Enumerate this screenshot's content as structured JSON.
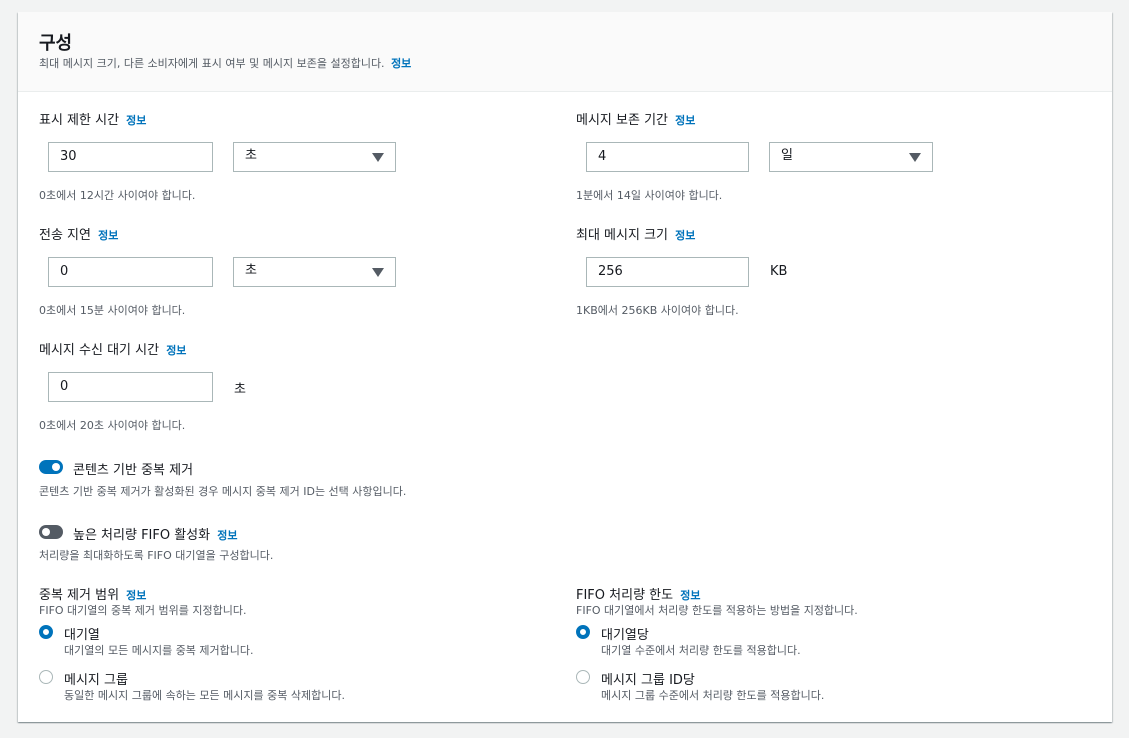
{
  "section": {
    "title": "구성",
    "description": "최대 메시지 크기, 다른 소비자에게 표시 여부 및 메시지 보존을 설정합니다.",
    "info": "정보"
  },
  "visibility_timeout": {
    "label": "표시 제한 시간",
    "info": "정보",
    "value": "30",
    "unit": "초",
    "hint": "0초에서 12시간 사이여야 합니다."
  },
  "retention_period": {
    "label": "메시지 보존 기간",
    "info": "정보",
    "value": "4",
    "unit": "일",
    "hint": "1분에서 14일 사이여야 합니다."
  },
  "delivery_delay": {
    "label": "전송 지연",
    "info": "정보",
    "value": "0",
    "unit": "초",
    "hint": "0초에서 15분 사이여야 합니다."
  },
  "max_message_size": {
    "label": "최대 메시지 크기",
    "info": "정보",
    "value": "256",
    "unit": "KB",
    "hint": "1KB에서 256KB 사이여야 합니다."
  },
  "receive_wait_time": {
    "label": "메시지 수신 대기 시간",
    "info": "정보",
    "value": "0",
    "unit": "초",
    "hint": "0초에서 20초 사이여야 합니다."
  },
  "content_dedup": {
    "label": "콘텐츠 기반 중복 제거",
    "description": "콘텐츠 기반 중복 제거가 활성화된 경우 메시지 중복 제거 ID는 선택 사항입니다.",
    "enabled": true
  },
  "high_throughput": {
    "label": "높은 처리량 FIFO 활성화",
    "info": "정보",
    "description": "처리량을 최대화하도록 FIFO 대기열을 구성합니다.",
    "enabled": false
  },
  "dedup_scope": {
    "label": "중복 제거 범위",
    "info": "정보",
    "description": "FIFO 대기열의 중복 제거 범위를 지정합니다.",
    "options": [
      {
        "label": "대기열",
        "description": "대기열의 모든 메시지를 중복 제거합니다.",
        "selected": true
      },
      {
        "label": "메시지 그룹",
        "description": "동일한 메시지 그룹에 속하는 모든 메시지를 중복 삭제합니다.",
        "selected": false
      }
    ]
  },
  "throughput_limit": {
    "label": "FIFO 처리량 한도",
    "info": "정보",
    "description": "FIFO 대기열에서 처리량 한도를 적용하는 방법을 지정합니다.",
    "options": [
      {
        "label": "대기열당",
        "description": "대기열 수준에서 처리량 한도를 적용합니다.",
        "selected": true
      },
      {
        "label": "메시지 그룹 ID당",
        "description": "메시지 그룹 수준에서 처리량 한도를 적용합니다.",
        "selected": false
      }
    ]
  },
  "colors": {
    "link": "#0073bb",
    "toggle_on": "#0073bb",
    "toggle_off": "#545b64",
    "border": "#aab7b8"
  }
}
